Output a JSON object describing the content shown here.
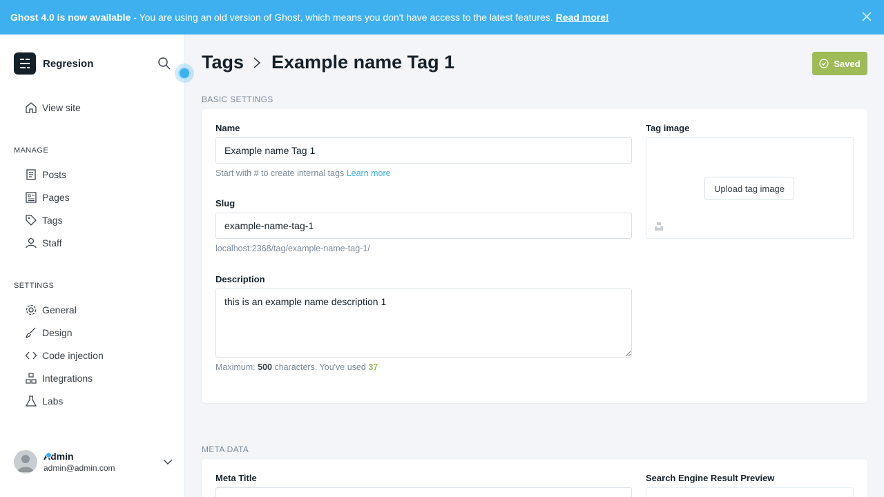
{
  "banner": {
    "headline": "Ghost 4.0 is now available",
    "message": "- You are using an old version of Ghost, which means you don't have access to the latest features.",
    "link": "Read more!"
  },
  "sidebar": {
    "brand": "Regresion",
    "view_site": "View site",
    "manage_heading": "MANAGE",
    "manage_items": [
      "Posts",
      "Pages",
      "Tags",
      "Staff"
    ],
    "settings_heading": "SETTINGS",
    "settings_items": [
      "General",
      "Design",
      "Code injection",
      "Integrations",
      "Labs"
    ],
    "user": {
      "name": "Admin",
      "email": "admin@admin.com"
    }
  },
  "header": {
    "breadcrumb": "Tags",
    "title": "Example name Tag 1",
    "saved_label": "Saved"
  },
  "basic": {
    "section": "BASIC SETTINGS",
    "name_label": "Name",
    "name_value": "Example name Tag 1",
    "name_hint": "Start with # to create internal tags",
    "name_hint_link": "Learn more",
    "slug_label": "Slug",
    "slug_value": "example-name-tag-1",
    "slug_url": "localhost:2368/tag/example-name-tag-1/",
    "desc_label": "Description",
    "desc_value": "this is an example name description 1",
    "desc_hint_prefix": "Maximum:",
    "desc_max": "500",
    "desc_hint_middle": "characters. You've used",
    "desc_used": "37",
    "image_label": "Tag image",
    "upload_label": "Upload tag image"
  },
  "meta": {
    "section": "META DATA",
    "meta_title_label": "Meta Title",
    "preview_label": "Search Engine Result Preview"
  },
  "colors": {
    "accent": "#3eb0ef",
    "saved": "#9fbb58",
    "sidebar_bg": "#ffffff",
    "page_bg": "#f4f5f8"
  }
}
